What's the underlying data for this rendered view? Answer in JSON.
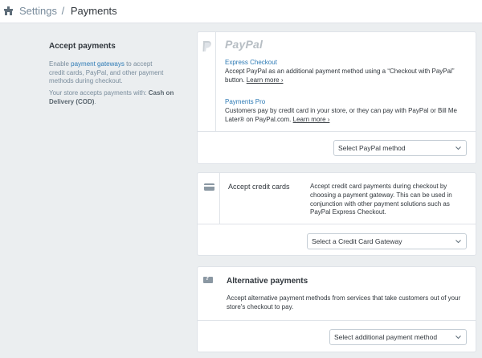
{
  "header": {
    "parent": "Settings",
    "separator": "/",
    "current": "Payments"
  },
  "intro": {
    "title": "Accept payments",
    "desc_prefix": "Enable ",
    "desc_link": "payment gateways",
    "desc_suffix": " to accept credit cards, PayPal, and other payment methods during checkout.",
    "store_prefix": "Your store accepts payments with: ",
    "store_methods": "Cash on Delivery (COD)",
    "store_suffix": "."
  },
  "paypal": {
    "brand": "PayPal",
    "options": [
      {
        "title": "Express Checkout",
        "desc": "Accept PayPal as an additional payment method using a “Checkout with PayPal” button.",
        "link": "Learn more ›"
      },
      {
        "title": "Payments Pro",
        "desc": "Customers pay by credit card in your store, or they can pay with PayPal or Bill Me Later® on PayPal.com.",
        "link": "Learn more ›"
      }
    ],
    "select_value": "Select PayPal method"
  },
  "credit_cards": {
    "title": "Accept credit cards",
    "desc": "Accept credit card payments during checkout by choosing a payment gateway. This can be used in conjunction with other payment solutions such as PayPal Express Checkout.",
    "select_value": "Select a Credit Card Gateway"
  },
  "alternative": {
    "title": "Alternative payments",
    "desc": "Accept alternative payment methods from services that take customers out of your store's checkout to pay.",
    "select_value": "Select additional payment method"
  },
  "icons": {
    "store": "store-icon",
    "paypal": "paypal-icon",
    "credit_card": "credit-card-icon",
    "alternative": "question-card-icon",
    "chevron": "chevron-down-icon"
  },
  "colors": {
    "background": "#ebeef0",
    "link": "#2d7ab5",
    "text": "#31373d",
    "muted": "#798c9c",
    "border": "#dfe3e8"
  }
}
